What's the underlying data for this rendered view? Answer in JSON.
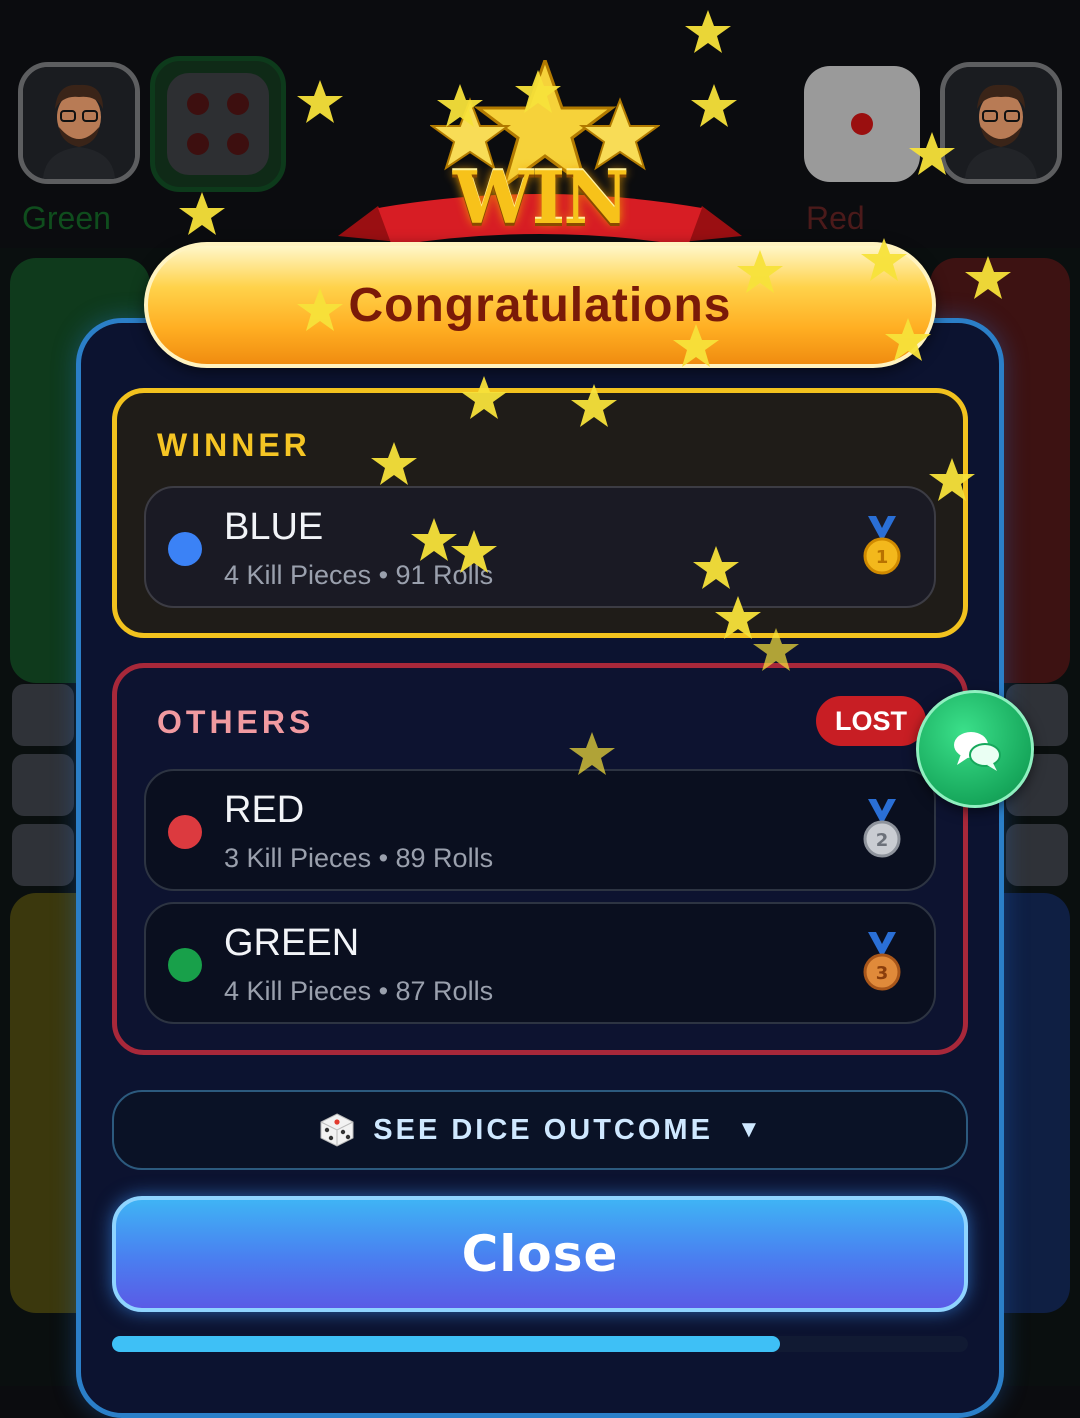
{
  "players": {
    "left": {
      "name": "Green",
      "color": "#0f4d1d",
      "dice_value": 4
    },
    "right": {
      "name": "Red",
      "color": "#4b1a1a",
      "dice_value": 1
    }
  },
  "banner": {
    "win_text": "WIN",
    "congrats_text": "Congratulations"
  },
  "winner": {
    "title": "WINNER",
    "name": "BLUE",
    "color": "#3b82f6",
    "stats": "4 Kill Pieces • 91 Rolls",
    "medal": "1"
  },
  "others": {
    "title": "OTHERS",
    "badge": "LOST",
    "players": [
      {
        "name": "RED",
        "color": "#dc3a3f",
        "stats": "3 Kill Pieces • 89 Rolls",
        "medal": "2"
      },
      {
        "name": "GREEN",
        "color": "#18a04a",
        "stats": "4 Kill Pieces • 87 Rolls",
        "medal": "3"
      }
    ]
  },
  "dice_outcome": {
    "label": "SEE DICE OUTCOME",
    "chevron": "▼",
    "icon": "dice-icon"
  },
  "close_label": "Close",
  "progress": {
    "fraction": 0.78
  },
  "chat": {
    "icon": "chat-bubbles-icon",
    "color": "#17a85c"
  }
}
